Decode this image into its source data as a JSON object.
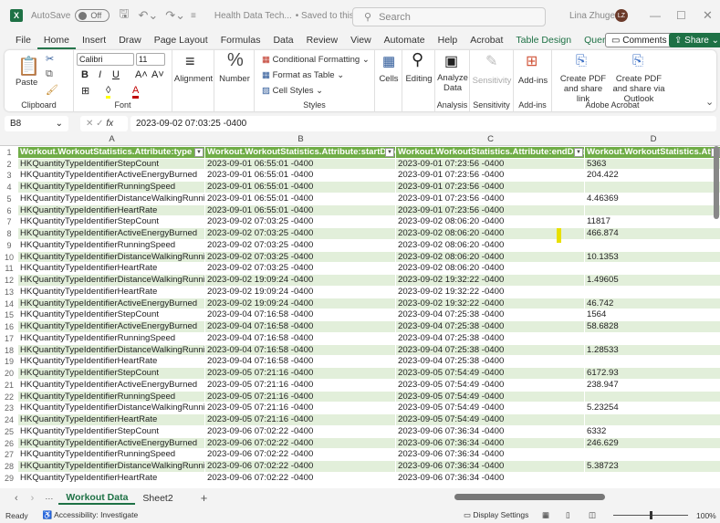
{
  "titlebar": {
    "app_icon": "X",
    "autosave_label": "AutoSave",
    "autosave_state": "Off",
    "doc_title": "Health Data Tech...",
    "save_status": "• Saved to this PC ⌄",
    "search_placeholder": "Search",
    "user_name": "Lina Zhuge",
    "user_initials": "LZ"
  },
  "menu": {
    "tabs": [
      "File",
      "Home",
      "Insert",
      "Draw",
      "Page Layout",
      "Formulas",
      "Data",
      "Review",
      "View",
      "Automate",
      "Help",
      "Acrobat",
      "Table Design",
      "Query"
    ],
    "comments": "Comments",
    "share": "Share"
  },
  "ribbon": {
    "paste": "Paste",
    "clipboard": "Clipboard",
    "font_name": "Calibri",
    "font_size": "11",
    "font": "Font",
    "alignment": "Alignment",
    "number": "Number",
    "cond_format": "Conditional Formatting",
    "format_table": "Format as Table",
    "cell_styles": "Cell Styles",
    "styles": "Styles",
    "cells": "Cells",
    "editing": "Editing",
    "analyze_data": "Analyze Data",
    "analysis": "Analysis",
    "sensitivity": "Sensitivity",
    "sensitivity_group": "Sensitivity",
    "addins": "Add-ins",
    "addins_group": "Add-ins",
    "create_pdf_link": "Create PDF and share link",
    "create_pdf_outlook": "Create PDF and share via Outlook",
    "adobe": "Adobe Acrobat"
  },
  "formula": {
    "name_box": "B8",
    "fx": "fx",
    "value": "2023-09-02 07:03:25 -0400"
  },
  "columns": [
    "A",
    "B",
    "C",
    "D"
  ],
  "table": {
    "headers": [
      "Workout.WorkoutStatistics.Attribute:type",
      "Workout.WorkoutStatistics.Attribute:startDate",
      "Workout.WorkoutStatistics.Attribute:endDate",
      "Workout.WorkoutStatistics.Attribute:sum"
    ],
    "rows": [
      [
        "HKQuantityTypeIdentifierStepCount",
        "2023-09-01 06:55:01 -0400",
        "2023-09-01 07:23:56 -0400",
        "5363"
      ],
      [
        "HKQuantityTypeIdentifierActiveEnergyBurned",
        "2023-09-01 06:55:01 -0400",
        "2023-09-01 07:23:56 -0400",
        "204.422"
      ],
      [
        "HKQuantityTypeIdentifierRunningSpeed",
        "2023-09-01 06:55:01 -0400",
        "2023-09-01 07:23:56 -0400",
        ""
      ],
      [
        "HKQuantityTypeIdentifierDistanceWalkingRunning",
        "2023-09-01 06:55:01 -0400",
        "2023-09-01 07:23:56 -0400",
        "4.46369"
      ],
      [
        "HKQuantityTypeIdentifierHeartRate",
        "2023-09-01 06:55:01 -0400",
        "2023-09-01 07:23:56 -0400",
        ""
      ],
      [
        "HKQuantityTypeIdentifierStepCount",
        "2023-09-02 07:03:25 -0400",
        "2023-09-02 08:06:20 -0400",
        "11817"
      ],
      [
        "HKQuantityTypeIdentifierActiveEnergyBurned",
        "2023-09-02 07:03:25 -0400",
        "2023-09-02 08:06:20 -0400",
        "466.874"
      ],
      [
        "HKQuantityTypeIdentifierRunningSpeed",
        "2023-09-02 07:03:25 -0400",
        "2023-09-02 08:06:20 -0400",
        ""
      ],
      [
        "HKQuantityTypeIdentifierDistanceWalkingRunning",
        "2023-09-02 07:03:25 -0400",
        "2023-09-02 08:06:20 -0400",
        "10.1353"
      ],
      [
        "HKQuantityTypeIdentifierHeartRate",
        "2023-09-02 07:03:25 -0400",
        "2023-09-02 08:06:20 -0400",
        ""
      ],
      [
        "HKQuantityTypeIdentifierDistanceWalkingRunning",
        "2023-09-02 19:09:24 -0400",
        "2023-09-02 19:32:22 -0400",
        "1.49605"
      ],
      [
        "HKQuantityTypeIdentifierHeartRate",
        "2023-09-02 19:09:24 -0400",
        "2023-09-02 19:32:22 -0400",
        ""
      ],
      [
        "HKQuantityTypeIdentifierActiveEnergyBurned",
        "2023-09-02 19:09:24 -0400",
        "2023-09-02 19:32:22 -0400",
        "46.742"
      ],
      [
        "HKQuantityTypeIdentifierStepCount",
        "2023-09-04 07:16:58 -0400",
        "2023-09-04 07:25:38 -0400",
        "1564"
      ],
      [
        "HKQuantityTypeIdentifierActiveEnergyBurned",
        "2023-09-04 07:16:58 -0400",
        "2023-09-04 07:25:38 -0400",
        "58.6828"
      ],
      [
        "HKQuantityTypeIdentifierRunningSpeed",
        "2023-09-04 07:16:58 -0400",
        "2023-09-04 07:25:38 -0400",
        ""
      ],
      [
        "HKQuantityTypeIdentifierDistanceWalkingRunning",
        "2023-09-04 07:16:58 -0400",
        "2023-09-04 07:25:38 -0400",
        "1.28533"
      ],
      [
        "HKQuantityTypeIdentifierHeartRate",
        "2023-09-04 07:16:58 -0400",
        "2023-09-04 07:25:38 -0400",
        ""
      ],
      [
        "HKQuantityTypeIdentifierStepCount",
        "2023-09-05 07:21:16 -0400",
        "2023-09-05 07:54:49 -0400",
        "6172.93"
      ],
      [
        "HKQuantityTypeIdentifierActiveEnergyBurned",
        "2023-09-05 07:21:16 -0400",
        "2023-09-05 07:54:49 -0400",
        "238.947"
      ],
      [
        "HKQuantityTypeIdentifierRunningSpeed",
        "2023-09-05 07:21:16 -0400",
        "2023-09-05 07:54:49 -0400",
        ""
      ],
      [
        "HKQuantityTypeIdentifierDistanceWalkingRunning",
        "2023-09-05 07:21:16 -0400",
        "2023-09-05 07:54:49 -0400",
        "5.23254"
      ],
      [
        "HKQuantityTypeIdentifierHeartRate",
        "2023-09-05 07:21:16 -0400",
        "2023-09-05 07:54:49 -0400",
        ""
      ],
      [
        "HKQuantityTypeIdentifierStepCount",
        "2023-09-06 07:02:22 -0400",
        "2023-09-06 07:36:34 -0400",
        "6332"
      ],
      [
        "HKQuantityTypeIdentifierActiveEnergyBurned",
        "2023-09-06 07:02:22 -0400",
        "2023-09-06 07:36:34 -0400",
        "246.629"
      ],
      [
        "HKQuantityTypeIdentifierRunningSpeed",
        "2023-09-06 07:02:22 -0400",
        "2023-09-06 07:36:34 -0400",
        ""
      ],
      [
        "HKQuantityTypeIdentifierDistanceWalkingRunning",
        "2023-09-06 07:02:22 -0400",
        "2023-09-06 07:36:34 -0400",
        "5.38723"
      ],
      [
        "HKQuantityTypeIdentifierHeartRate",
        "2023-09-06 07:02:22 -0400",
        "2023-09-06 07:36:34 -0400",
        ""
      ]
    ]
  },
  "sheets": {
    "tabs": [
      "Workout Data",
      "Sheet2"
    ],
    "add": "+",
    "more": "···"
  },
  "status": {
    "ready": "Ready",
    "accessibility": "Accessibility: Investigate",
    "display_settings": "Display Settings",
    "zoom": "100%",
    "zoom_fraction": 0.5
  },
  "colors": {
    "accent": "#1e7145",
    "table_header": "#70ad47",
    "band": "#e2efda"
  }
}
